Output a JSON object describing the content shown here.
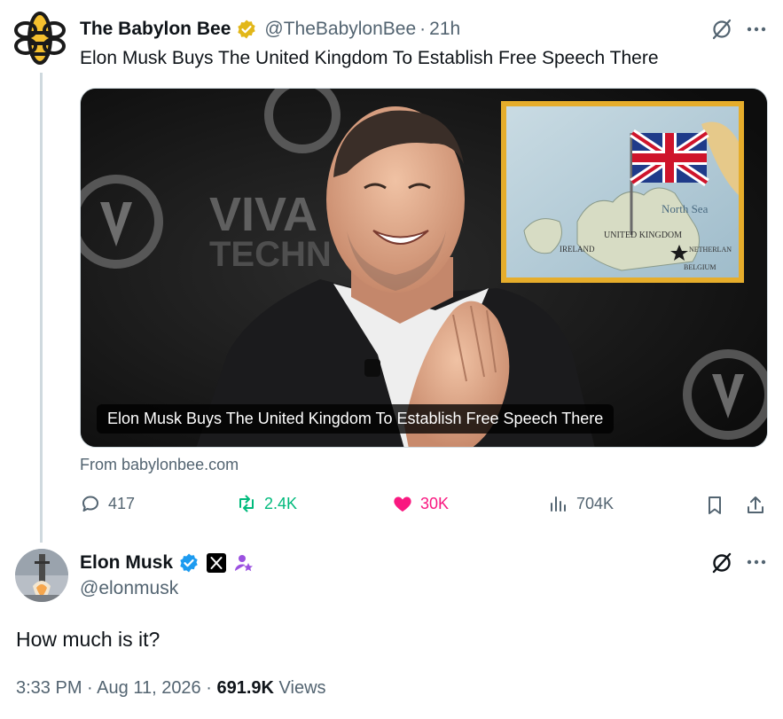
{
  "parent_tweet": {
    "author_name": "The Babylon Bee",
    "handle": "@TheBabylonBee",
    "time": "21h",
    "text": "Elon Musk Buys The United Kingdom To Establish Free Speech There",
    "card": {
      "caption": "Elon Musk Buys The United Kingdom To Establish Free Speech There",
      "source": "From babylonbee.com",
      "image_text": {
        "viva": "VIVA",
        "tech": "TECHN",
        "north_sea": "North Sea",
        "united_kingdom": "UNITED KINGDOM",
        "ireland": "IRELAND",
        "belgium": "BELGIUM",
        "netherlands": "NETHERLAN"
      }
    },
    "stats": {
      "replies": "417",
      "reposts": "2.4K",
      "likes": "30K",
      "views": "704K"
    }
  },
  "main_tweet": {
    "author_name": "Elon Musk",
    "handle": "@elonmusk",
    "text": "How much is it?",
    "time": "3:33 PM",
    "date": "Aug 11, 2026",
    "views_count": "691.9K",
    "views_label": "Views"
  },
  "colors": {
    "text": "#0f1419",
    "secondary": "#536471",
    "verified_blue": "#1d9bf0",
    "gold": "#e2b719",
    "retweet": "#00ba7c",
    "like": "#f91880",
    "thread_line": "#cfd9de"
  },
  "icons": [
    "bee-logo-icon",
    "gold-check-icon",
    "grok-icon",
    "more-icon",
    "reply-icon",
    "retweet-icon",
    "heart-icon",
    "views-icon",
    "bookmark-icon",
    "share-icon",
    "verified-icon",
    "x-logo-icon",
    "affiliate-icon"
  ]
}
